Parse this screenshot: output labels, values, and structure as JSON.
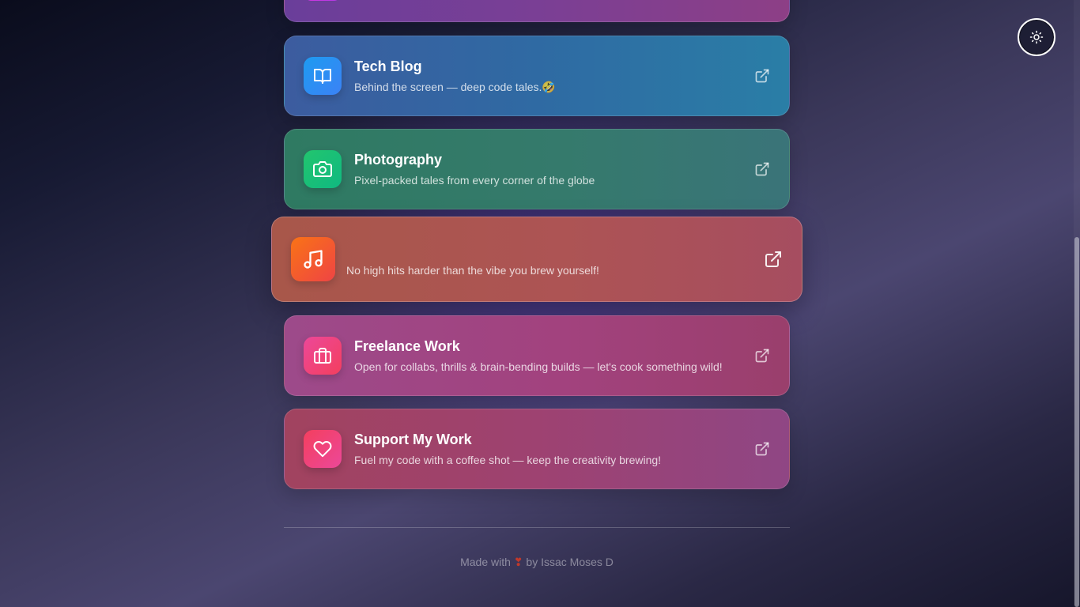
{
  "theme_toggle": {
    "icon": "sun-icon"
  },
  "cards": [
    {
      "key": "partial-top",
      "title": "",
      "description": "",
      "icon": "partial-icon"
    },
    {
      "key": "tech-blog",
      "title": "Tech Blog",
      "description": "Behind the screen — deep code tales.🤣",
      "icon": "book-open-icon",
      "icon_gradient": [
        "#1e9bf0",
        "#3b82f6"
      ]
    },
    {
      "key": "photography",
      "title": "Photography",
      "description": "Pixel-packed tales from every corner of the globe",
      "icon": "camera-icon",
      "icon_gradient": [
        "#22c56e",
        "#10b981"
      ]
    },
    {
      "key": "music",
      "title": "",
      "description": "No high hits harder than the vibe you brew yourself!",
      "icon": "music-note-icon",
      "icon_gradient": [
        "#f97316",
        "#ef4444"
      ]
    },
    {
      "key": "freelance-work",
      "title": "Freelance Work",
      "description": "Open for collabs, thrills & brain-bending builds — let's cook something wild!",
      "icon": "briefcase-icon",
      "icon_gradient": [
        "#ec4899",
        "#f43f5e"
      ]
    },
    {
      "key": "support-my-work",
      "title": "Support My Work",
      "description": "Fuel my code with a coffee shot — keep the creativity brewing!",
      "icon": "heart-icon",
      "icon_gradient": [
        "#f43f5e",
        "#ec4899"
      ]
    }
  ],
  "external_link_icon": "external-link-icon",
  "footer": {
    "prefix": "Made with",
    "heart": "❣",
    "suffix": "by Issac Moses D"
  }
}
